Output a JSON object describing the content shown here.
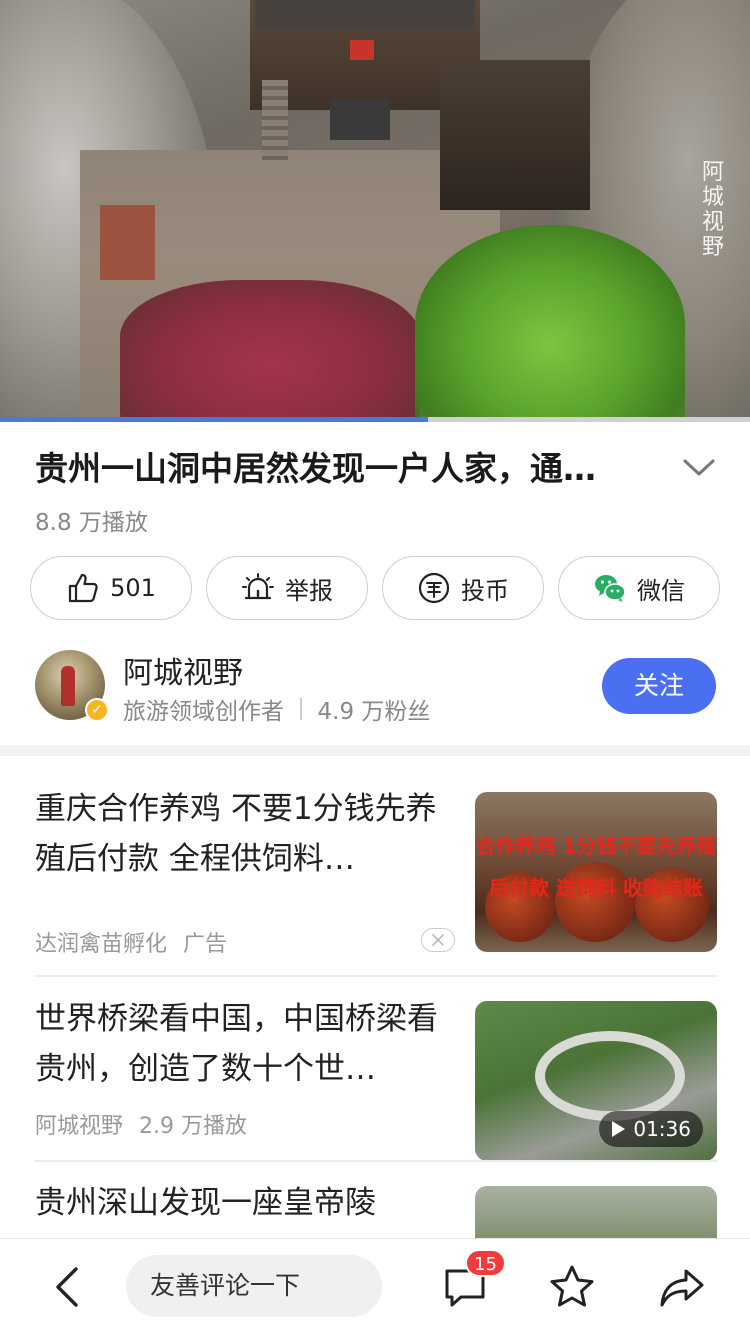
{
  "video": {
    "watermark": "阿城视野",
    "progress": 0.57
  },
  "title": "贵州一山洞中居然发现一户人家，通…",
  "views": "8.8 万播放",
  "actions": {
    "like_count": "501",
    "report_label": "举报",
    "coin_label": "投币",
    "wechat_label": "微信"
  },
  "author": {
    "name": "阿城视野",
    "role": "旅游领域创作者",
    "fans": "4.9 万粉丝",
    "follow_label": "关注",
    "badge_icon": "verified-icon"
  },
  "feed": [
    {
      "title": "重庆合作养鸡 不要1分钱先养殖后付款 全程供饲料…",
      "source": "达润禽苗孵化",
      "tag": "广告",
      "thumb_text_1": "合作养鸡 1分钱不要先养殖",
      "thumb_text_2": "后付款 送饲料 收购结账"
    },
    {
      "title": "世界桥梁看中国，中国桥梁看贵州，创造了数十个世…",
      "source": "阿城视野",
      "views": "2.9 万播放",
      "duration": "01:36"
    },
    {
      "title": "贵州深山发现一座皇帝陵"
    }
  ],
  "bottom_bar": {
    "comment_placeholder": "友善评论一下",
    "comment_count": "15"
  },
  "colors": {
    "accent": "#4a6ff0",
    "progress": "#4a78e0",
    "badge": "#ef3b3b",
    "wechat": "#2aae67"
  }
}
